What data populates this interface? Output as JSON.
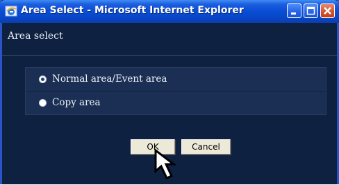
{
  "window": {
    "title": "Area Select - Microsoft Internet Explorer",
    "icon": "ie-icon"
  },
  "page": {
    "heading": "Area select",
    "options": [
      {
        "label": "Normal area/Event area",
        "selected": true
      },
      {
        "label": "Copy area",
        "selected": false
      }
    ],
    "buttons": {
      "ok_label": "OK",
      "cancel_label": "Cancel"
    }
  },
  "colors": {
    "titlebar": "#0747c9",
    "background": "#0f2140",
    "option_row": "#1b2f55",
    "button_face": "#ece9d8"
  }
}
